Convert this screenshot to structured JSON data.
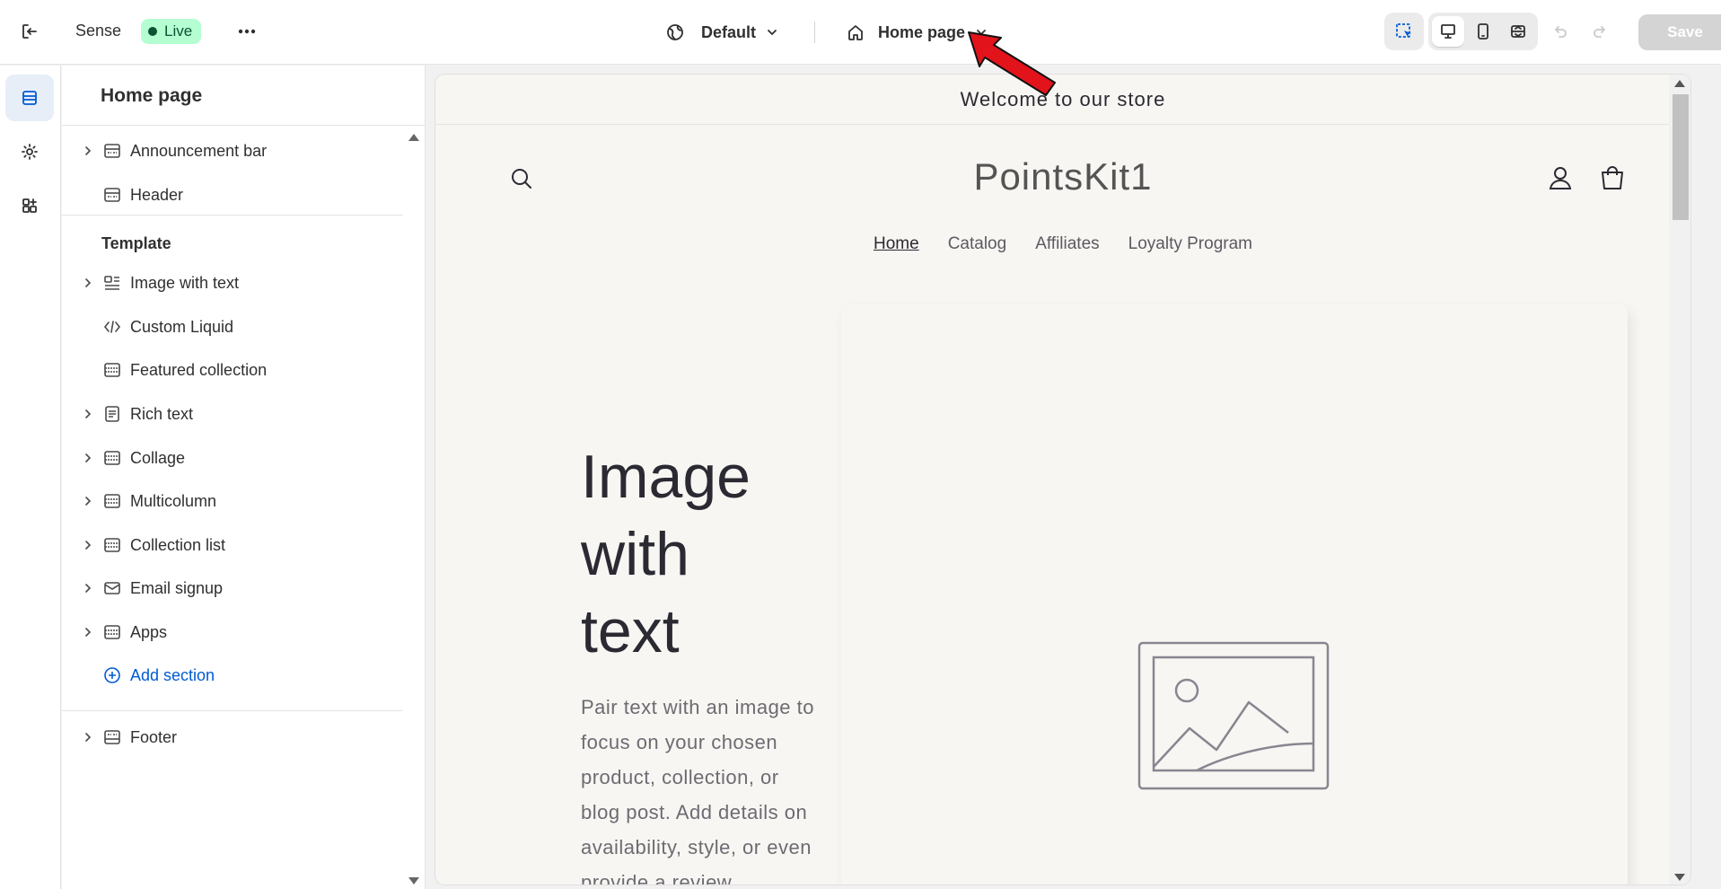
{
  "topbar": {
    "theme_name": "Sense",
    "status_badge": "Live",
    "theme_selector": "Default",
    "page_selector": "Home page",
    "save_label": "Save"
  },
  "panel": {
    "title": "Home page",
    "header_group": [
      {
        "label": "Announcement bar",
        "has_chevron": true,
        "icon": "section-icon"
      },
      {
        "label": "Header",
        "has_chevron": false,
        "icon": "section-icon"
      }
    ],
    "template_label": "Template",
    "template_items": [
      {
        "label": "Image with text",
        "has_chevron": true,
        "icon": "image-with-text-icon"
      },
      {
        "label": "Custom Liquid",
        "has_chevron": false,
        "icon": "code-icon"
      },
      {
        "label": "Featured collection",
        "has_chevron": false,
        "icon": "section-icon"
      },
      {
        "label": "Rich text",
        "has_chevron": true,
        "icon": "rich-text-icon"
      },
      {
        "label": "Collage",
        "has_chevron": true,
        "icon": "section-icon"
      },
      {
        "label": "Multicolumn",
        "has_chevron": true,
        "icon": "section-icon"
      },
      {
        "label": "Collection list",
        "has_chevron": true,
        "icon": "section-icon"
      },
      {
        "label": "Email signup",
        "has_chevron": true,
        "icon": "mail-icon"
      },
      {
        "label": "Apps",
        "has_chevron": true,
        "icon": "section-icon"
      }
    ],
    "add_section_label": "Add section",
    "footer_label": "Footer"
  },
  "preview": {
    "announcement": "Welcome to our store",
    "store_name": "PointsKit1",
    "nav": [
      "Home",
      "Catalog",
      "Affiliates",
      "Loyalty Program"
    ],
    "nav_current": "Home",
    "hero_heading_lines": [
      "Image",
      "with",
      "text"
    ],
    "hero_body": "Pair text with an image to focus on your chosen product, collection, or blog post. Add details on availability, style, or even provide a review."
  },
  "colors": {
    "accent_blue": "#005bd3",
    "live_badge_bg": "#b4fed2",
    "preview_bg": "#f8f6f2",
    "annotation_arrow": "#e3131b"
  }
}
